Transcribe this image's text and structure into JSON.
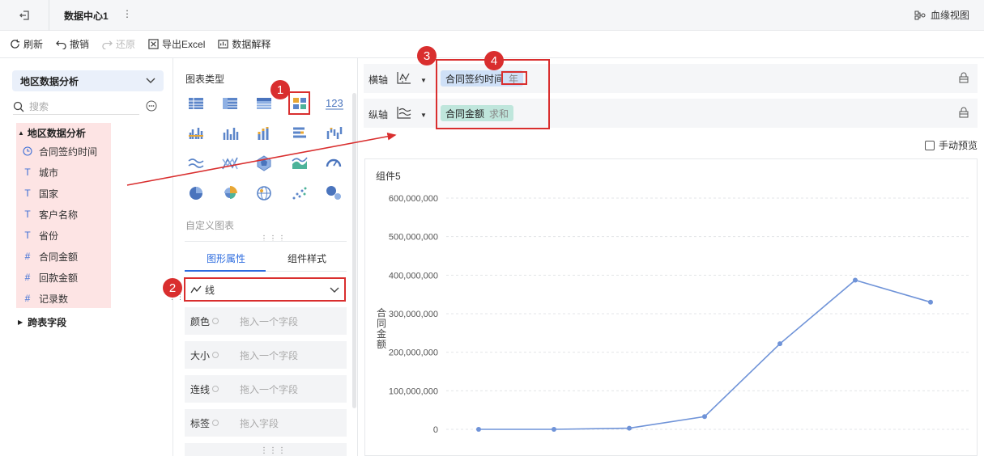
{
  "topbar": {
    "title": "数据中心1",
    "more": "⋮",
    "lineage_label": "血缘视图"
  },
  "toolbar": {
    "refresh": "刷新",
    "undo": "撤销",
    "redo": "还原",
    "export": "导出Excel",
    "explain": "数据解释"
  },
  "left": {
    "dataset": "地区数据分析",
    "search_placeholder": "搜索",
    "group_name": "地区数据分析",
    "fields": [
      {
        "type": "date",
        "label": "合同签约时间"
      },
      {
        "type": "text",
        "label": "城市"
      },
      {
        "type": "text",
        "label": "国家"
      },
      {
        "type": "text",
        "label": "客户名称"
      },
      {
        "type": "text",
        "label": "省份"
      },
      {
        "type": "number",
        "label": "合同金额"
      },
      {
        "type": "number",
        "label": "回款金额"
      },
      {
        "type": "count",
        "label": "记录数"
      }
    ],
    "cross_fields": "跨表字段"
  },
  "mid": {
    "chart_type_label": "图表类型",
    "custom_chart_label": "自定义图表",
    "tabs": [
      "图形属性",
      "组件样式"
    ],
    "mark_type": "线",
    "props": [
      {
        "label": "颜色",
        "placeholder": "拖入一个字段"
      },
      {
        "label": "大小",
        "placeholder": "拖入一个字段"
      },
      {
        "label": "连线",
        "placeholder": "拖入一个字段"
      },
      {
        "label": "标签",
        "placeholder": "拖入字段"
      }
    ]
  },
  "right": {
    "x_axis_label": "横轴",
    "y_axis_label": "纵轴",
    "x_field": "合同签约时间",
    "x_field_sub": "年",
    "y_field": "合同金额",
    "y_field_sub": "求和",
    "manual_preview": "手动预览",
    "component_title": "组件5"
  },
  "annotations": [
    "1",
    "2",
    "3",
    "4"
  ],
  "colors": {
    "accent": "#2d6cdf",
    "annotation_red": "#d92e2e",
    "line": "#6f93d8"
  },
  "chart_data": {
    "type": "line",
    "title": "",
    "ylabel": "合同金额",
    "xlabel": "",
    "y_ticks": [
      "0",
      "100,000,000",
      "200,000,000",
      "300,000,000",
      "400,000,000",
      "500,000,000",
      "600,000,000"
    ],
    "ylim": [
      0,
      600000000
    ],
    "series": [
      {
        "values": [
          0,
          0,
          3000000,
          33000000,
          222000000,
          387000000,
          330000000
        ]
      }
    ],
    "grid": true
  }
}
